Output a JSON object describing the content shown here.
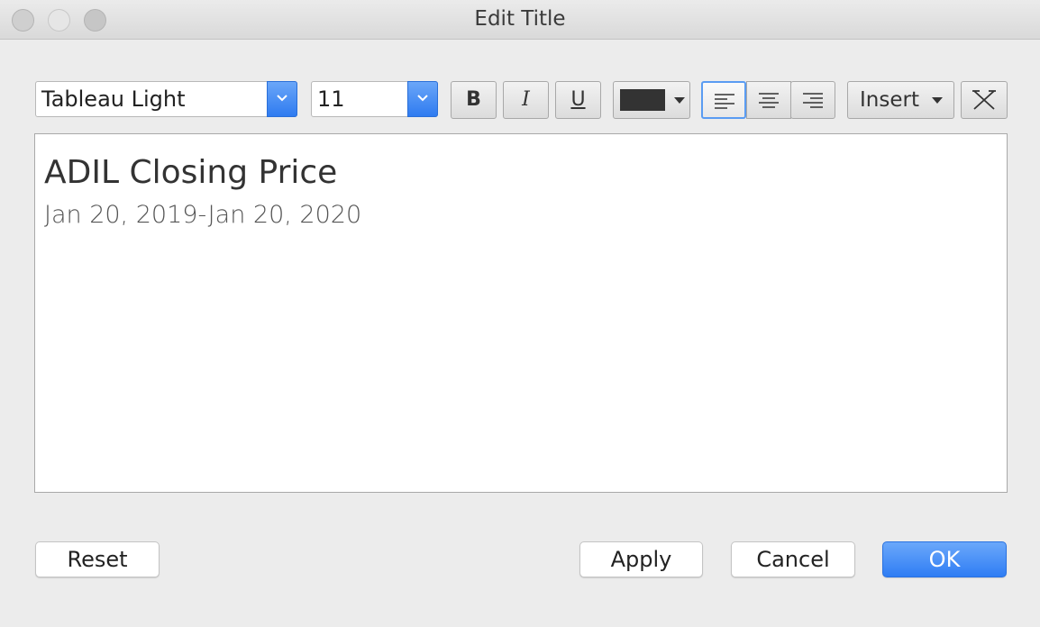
{
  "window": {
    "title": "Edit Title"
  },
  "toolbar": {
    "font_family": "Tableau Light",
    "font_size": "11",
    "bold_label": "B",
    "italic_label": "I",
    "underline_label": "U",
    "text_color": "#333333",
    "insert_label": "Insert",
    "align": "left"
  },
  "editor": {
    "line1": "ADIL Closing Price",
    "line2": "Jan 20, 2019-Jan 20, 2020"
  },
  "buttons": {
    "reset": "Reset",
    "apply": "Apply",
    "cancel": "Cancel",
    "ok": "OK"
  },
  "colors": {
    "accent": "#2f7df4"
  }
}
